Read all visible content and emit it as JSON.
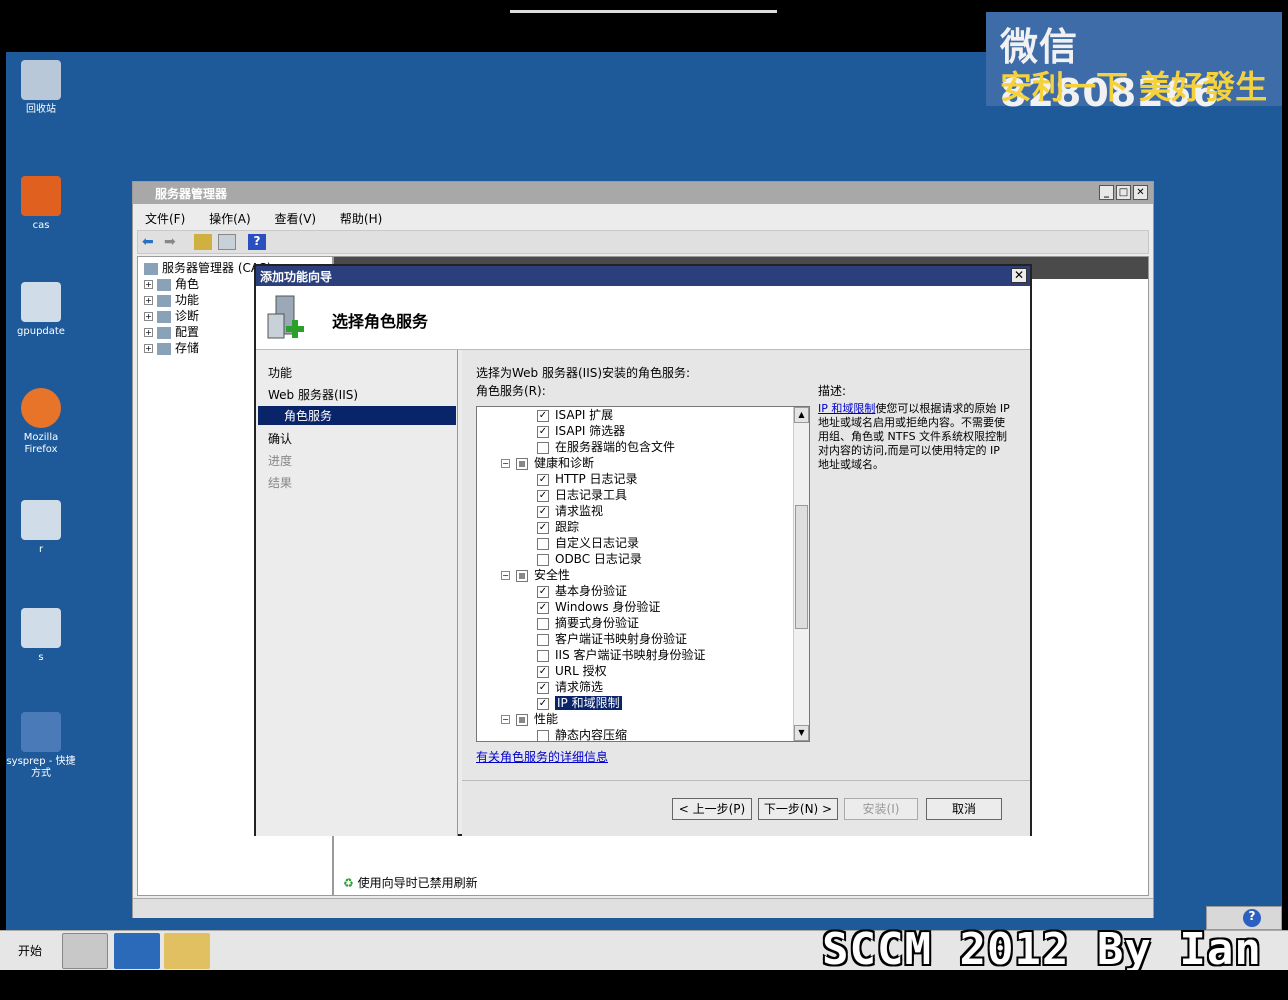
{
  "watermark": {
    "line1": "微信 82808266",
    "line2": "安利一下 美好發生"
  },
  "desktop_icons": [
    "回收站",
    "cas",
    "gpupdate",
    "Mozilla Firefox",
    "r",
    "s",
    "sysprep - 快捷方式"
  ],
  "server_manager": {
    "title": "服务器管理器",
    "menu": [
      "文件(F)",
      "操作(A)",
      "查看(V)",
      "帮助(H)"
    ],
    "tree": {
      "root": "服务器管理器 (CAS)",
      "items": [
        "角色",
        "功能",
        "诊断",
        "配置",
        "存储"
      ]
    },
    "status_refresh": "使用向导时已禁用刷新"
  },
  "wizard": {
    "title": "添加功能向导",
    "header": "选择角色服务",
    "nav": [
      "功能",
      "Web 服务器(IIS)",
      "角色服务",
      "确认",
      "进度",
      "结果"
    ],
    "select_label": "选择为Web 服务器(IIS)安装的角色服务:",
    "list_label": "角色服务(R):",
    "description_label": "描述:",
    "description_link": "IP 和域限制",
    "description_text": "使您可以根据请求的原始 IP 地址或域名启用或拒绝内容。不需要使用组、角色或 NTFS 文件系统权限控制对内容的访问,而是可以使用特定的 IP 地址或域名。",
    "services": [
      {
        "label": "ISAPI 扩展",
        "checked": true,
        "level": 2
      },
      {
        "label": "ISAPI 筛选器",
        "checked": true,
        "level": 2
      },
      {
        "label": "在服务器端的包含文件",
        "checked": false,
        "level": 2
      },
      {
        "label": "健康和诊断",
        "group": true,
        "level": 1
      },
      {
        "label": "HTTP 日志记录",
        "checked": true,
        "level": 2
      },
      {
        "label": "日志记录工具",
        "checked": true,
        "level": 2
      },
      {
        "label": "请求监视",
        "checked": true,
        "level": 2
      },
      {
        "label": "跟踪",
        "checked": true,
        "level": 2
      },
      {
        "label": "自定义日志记录",
        "checked": false,
        "level": 2
      },
      {
        "label": "ODBC 日志记录",
        "checked": false,
        "level": 2
      },
      {
        "label": "安全性",
        "group": true,
        "level": 1
      },
      {
        "label": "基本身份验证",
        "checked": true,
        "level": 2
      },
      {
        "label": "Windows 身份验证",
        "checked": true,
        "level": 2
      },
      {
        "label": "摘要式身份验证",
        "checked": false,
        "level": 2
      },
      {
        "label": "客户端证书映射身份验证",
        "checked": false,
        "level": 2
      },
      {
        "label": "IIS 客户端证书映射身份验证",
        "checked": false,
        "level": 2
      },
      {
        "label": "URL 授权",
        "checked": true,
        "level": 2
      },
      {
        "label": "请求筛选",
        "checked": true,
        "level": 2
      },
      {
        "label": "IP 和域限制",
        "checked": true,
        "level": 2,
        "selected": true
      },
      {
        "label": "性能",
        "group": true,
        "level": 1
      },
      {
        "label": "静态内容压缩",
        "checked": false,
        "level": 2
      }
    ],
    "more_link": "有关角色服务的详细信息",
    "buttons": {
      "prev": "< 上一步(P)",
      "next": "下一步(N) >",
      "install": "安装(I)",
      "cancel": "取消"
    }
  },
  "taskbar": {
    "start": "开始"
  },
  "overlay_text": "SCCM 2012 By Ian"
}
